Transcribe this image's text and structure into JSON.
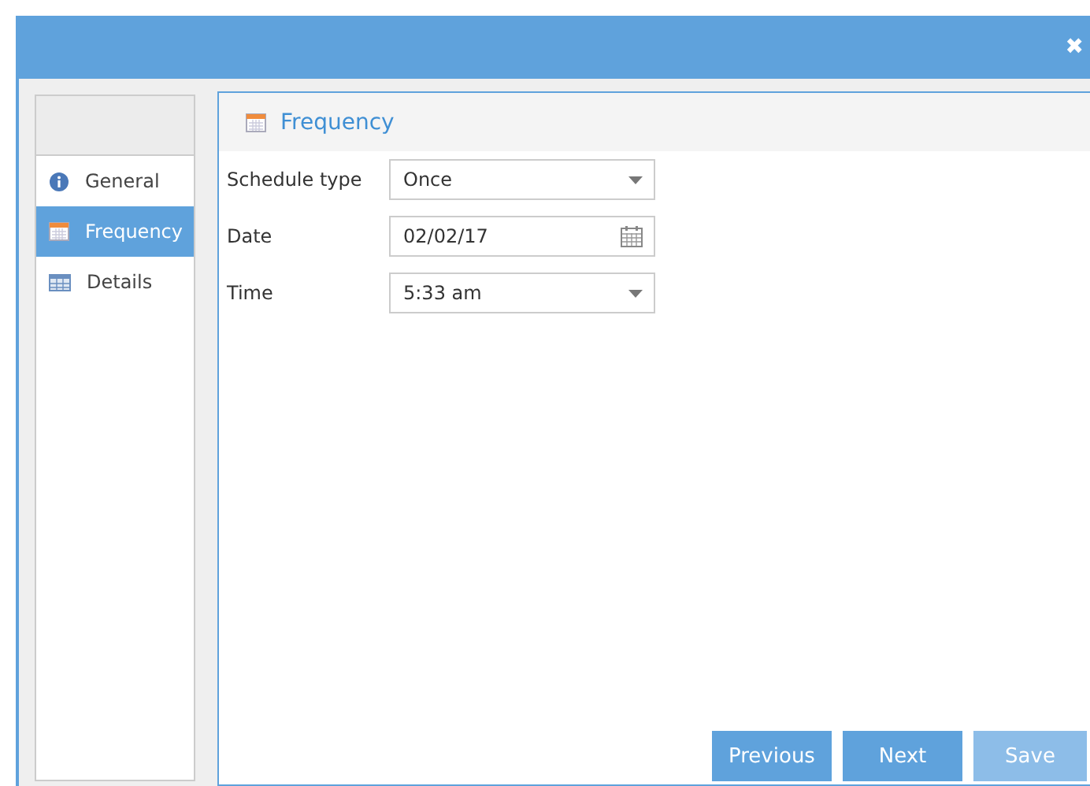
{
  "window": {
    "close_icon": "✖"
  },
  "sidebar": {
    "items": [
      {
        "label": "General",
        "kind": "info",
        "selected": false
      },
      {
        "label": "Frequency",
        "kind": "calendar",
        "selected": true
      },
      {
        "label": "Details",
        "kind": "table",
        "selected": false
      }
    ]
  },
  "panel": {
    "title": "Frequency",
    "fields": [
      {
        "label": "Schedule type",
        "value": "Once",
        "kind": "dropdown"
      },
      {
        "label": "Date",
        "value": "02/02/17",
        "kind": "date"
      },
      {
        "label": "Time",
        "value": "5:33 am",
        "kind": "dropdown"
      }
    ]
  },
  "buttons": [
    {
      "label": "Previous",
      "disabled": false
    },
    {
      "label": "Next",
      "disabled": false
    },
    {
      "label": "Save",
      "disabled": true
    }
  ]
}
